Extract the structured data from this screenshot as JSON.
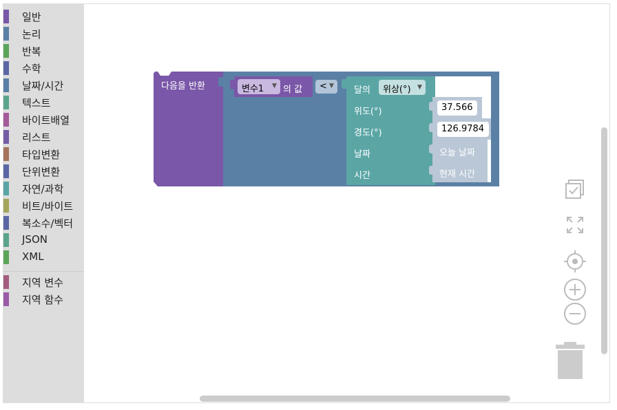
{
  "toolbox": {
    "categories": [
      {
        "label": "일반",
        "color": "#7a57a8"
      },
      {
        "label": "논리",
        "color": "#5b80a5"
      },
      {
        "label": "반복",
        "color": "#5ba55b"
      },
      {
        "label": "수학",
        "color": "#5b67a5"
      },
      {
        "label": "날짜/시간",
        "color": "#5b80a5"
      },
      {
        "label": "텍스트",
        "color": "#5ba58c"
      },
      {
        "label": "바이트배열",
        "color": "#a55b99"
      },
      {
        "label": "리스트",
        "color": "#745ba5"
      },
      {
        "label": "타입변환",
        "color": "#a5745b"
      },
      {
        "label": "단위변환",
        "color": "#5b67a5"
      },
      {
        "label": "자연/과학",
        "color": "#5ba5a5"
      },
      {
        "label": "비트/바이트",
        "color": "#a5a55b"
      },
      {
        "label": "복소수/벡터",
        "color": "#5b67a5"
      },
      {
        "label": "JSON",
        "color": "#5ba58c"
      },
      {
        "label": "XML",
        "color": "#5ba55b"
      }
    ],
    "variable_categories": [
      {
        "label": "지역 변수",
        "color": "#a55b80"
      },
      {
        "label": "지역 함수",
        "color": "#995ba5"
      }
    ]
  },
  "workspace": {
    "return_block": {
      "label": "다음을 반환",
      "color": "#7a57a8"
    },
    "compare_block": {
      "operator": "<",
      "color": "#5b80a5"
    },
    "variable_block": {
      "dropdown": "변수1",
      "suffix": "의 값"
    },
    "moon_block": {
      "label": "달의",
      "dropdown": "위상(°)",
      "latitude_label": "위도(°)",
      "latitude_value": "37.566",
      "longitude_label": "경도(°)",
      "longitude_value": "126.9784",
      "date_label": "날짜",
      "date_value": "오늘 날짜",
      "time_label": "시간",
      "time_value": "현재 시간",
      "color": "#5ba5a5"
    }
  }
}
